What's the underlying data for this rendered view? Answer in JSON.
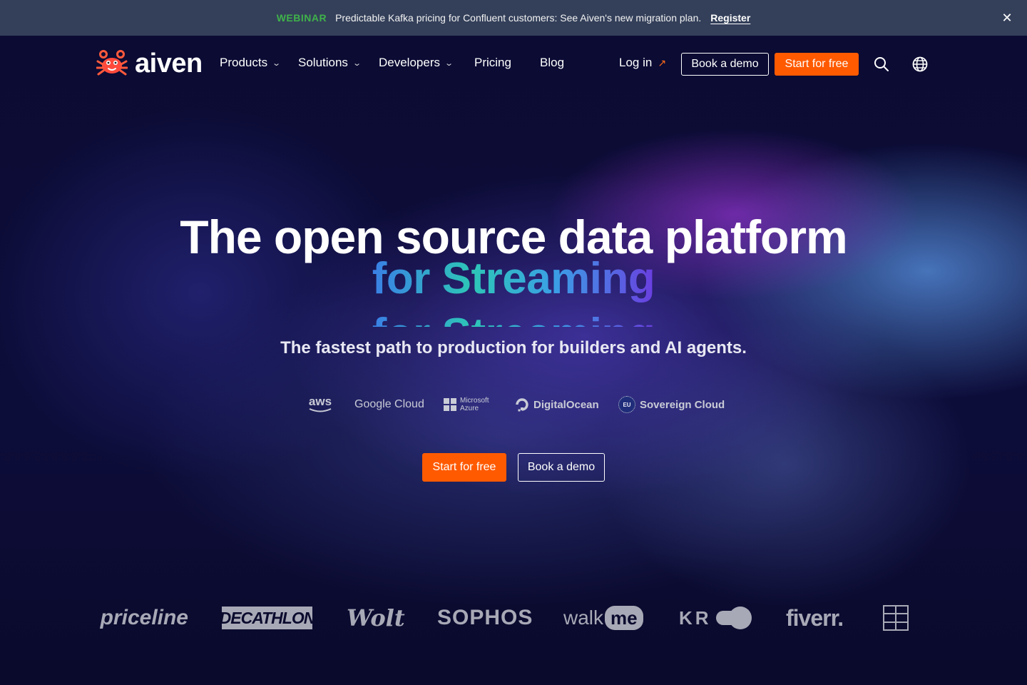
{
  "banner": {
    "tag": "WEBINAR",
    "message": "Predictable Kafka pricing for Confluent customers: See Aiven's new migration plan.",
    "link": "Register",
    "close_glyph": "✕"
  },
  "nav": {
    "brand": "aiven",
    "items": [
      {
        "label": "Products",
        "has_dropdown": true
      },
      {
        "label": "Solutions",
        "has_dropdown": true
      },
      {
        "label": "Developers",
        "has_dropdown": true
      },
      {
        "label": "Pricing",
        "has_dropdown": false
      },
      {
        "label": "Blog",
        "has_dropdown": false
      }
    ],
    "login": "Log in",
    "book_demo": "Book a demo",
    "start_free": "Start for free",
    "icons": [
      "search-icon",
      "globe-icon"
    ]
  },
  "hero": {
    "headline": "The open source data platform",
    "rotating_line": "for Streaming",
    "subheadline": "The fastest path to production for builders and AI agents.",
    "cta_primary": "Start for free",
    "cta_secondary": "Book a demo"
  },
  "clouds": {
    "aws": "aws",
    "google_cloud": "Google Cloud",
    "azure_line1": "Microsoft",
    "azure_line2": "Azure",
    "digitalocean": "DigitalOcean",
    "sovereign": "Sovereign Cloud",
    "eu_badge": "EU"
  },
  "customers": {
    "priceline": "priceline",
    "decathlon": "DECATHLON",
    "wolt": "Wolt",
    "sophos": "SOPHOS",
    "walkme_a": "walk",
    "walkme_b": "me",
    "kr": "KR",
    "fiverr": "fiverr."
  },
  "colors": {
    "accent_orange": "#ff5a00",
    "banner_bg": "#34405a",
    "webinar_green": "#3fb24a",
    "background": "#0b0b2e"
  }
}
